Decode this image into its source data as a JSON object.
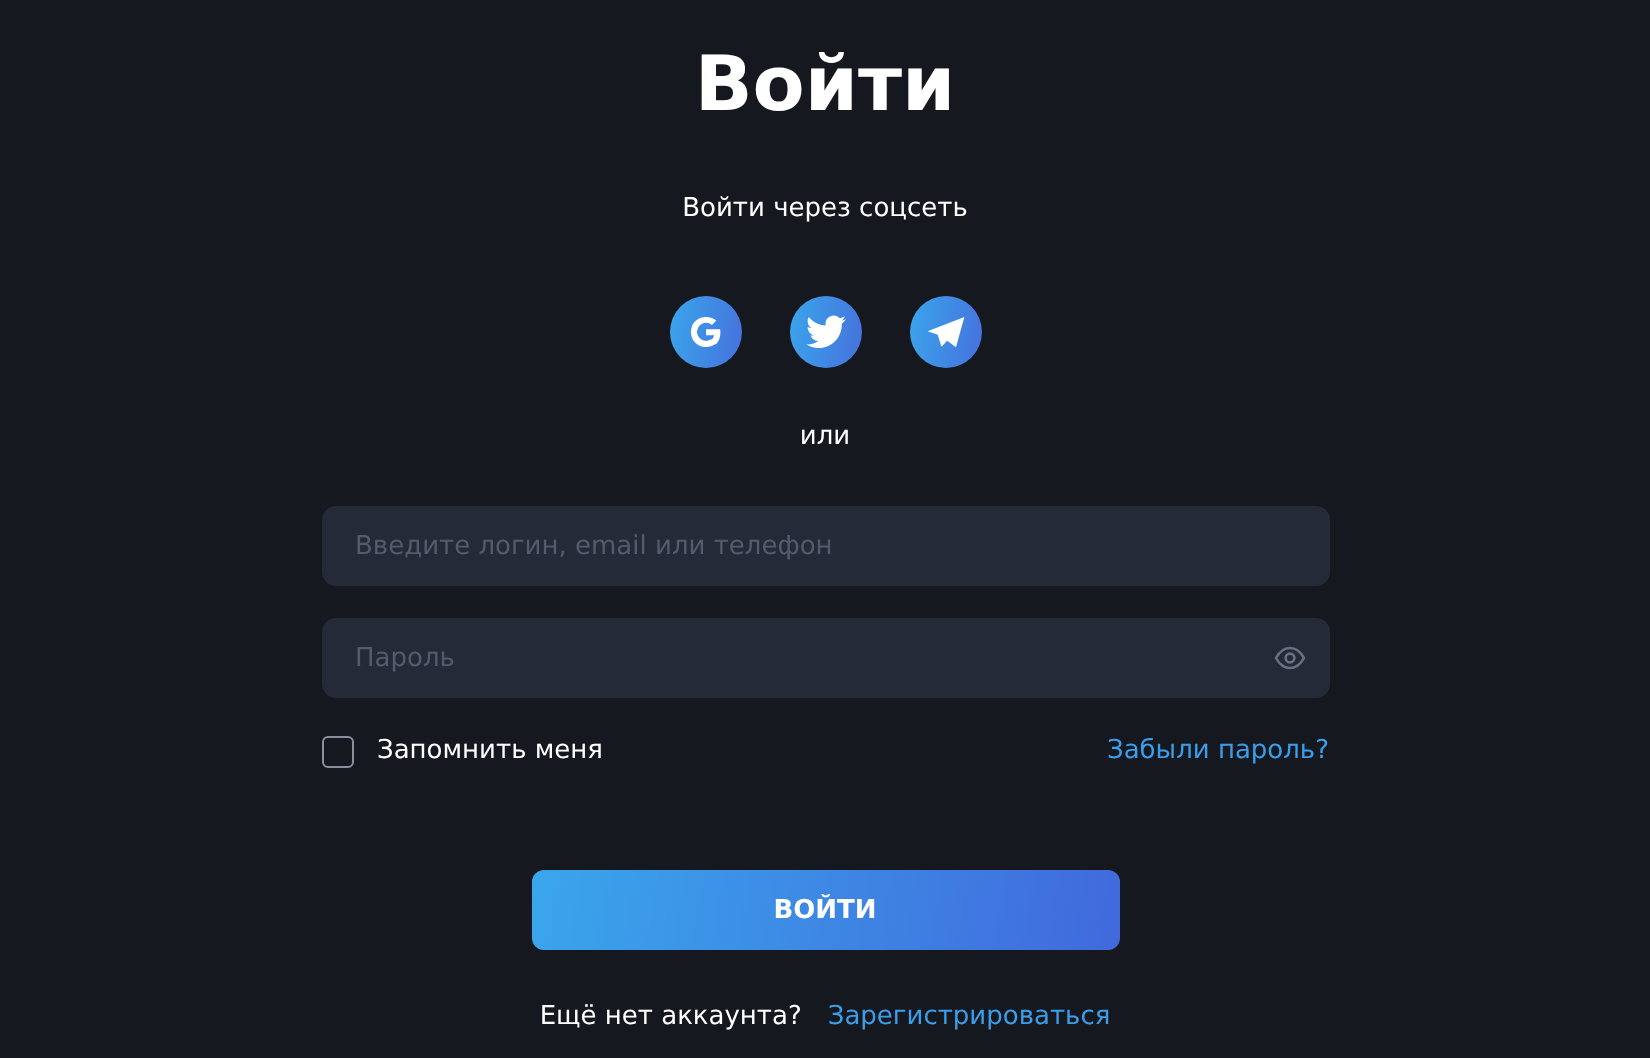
{
  "title": "Войти",
  "social": {
    "label": "Войти через соцсеть",
    "buttons": [
      {
        "kind": "google"
      },
      {
        "kind": "twitter"
      },
      {
        "kind": "telegram"
      }
    ]
  },
  "divider": "или",
  "fields": [
    {
      "kind": "text",
      "placeholder": "Введите логин, email или телефон"
    },
    {
      "kind": "password",
      "placeholder": "Пароль"
    }
  ],
  "remember": {
    "label": "Запомнить меня",
    "checked": false
  },
  "forgot_link": "Забыли пароль?",
  "submit": "ВОЙТИ",
  "signup": {
    "prompt": "Ещё нет аккаунта?",
    "link": "Зарегистрироваться"
  }
}
